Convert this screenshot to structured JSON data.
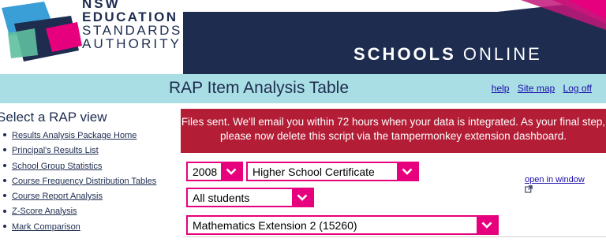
{
  "header": {
    "org_line1": "NSW",
    "org_line2": "EDUCATION",
    "org_line3": "STANDARDS",
    "org_line4": "AUTHORITY",
    "app_bold": "SCHOOLS",
    "app_light": "ONLINE"
  },
  "titlebar": {
    "title": "RAP Item Analysis Table",
    "links": {
      "help": "help",
      "site_map": "Site map",
      "log_off": "Log off"
    }
  },
  "sidebar": {
    "heading": "Select a RAP view",
    "items": [
      "Results Analysis Package Home",
      "Principal's Results List",
      "School Group Statistics",
      "Course Frequency Distribution Tables",
      "Course Report Analysis",
      "Z-Score Analysis",
      "Mark Comparison"
    ]
  },
  "alert": {
    "message": "Files sent. We'll email you within 72 hours when your data is integrated. As your final step, please now delete this script via the tampermonkey extension dashboard."
  },
  "filters": {
    "year": "2008",
    "certificate": "Higher School Certificate",
    "students": "All students",
    "course": "Mathematics Extension 2 (15260)",
    "open_window": "open in window"
  },
  "colors": {
    "navy": "#1d2c4f",
    "magenta": "#e6007e",
    "teal_bar": "#a9dfe4",
    "alert_red": "#b31d35"
  }
}
